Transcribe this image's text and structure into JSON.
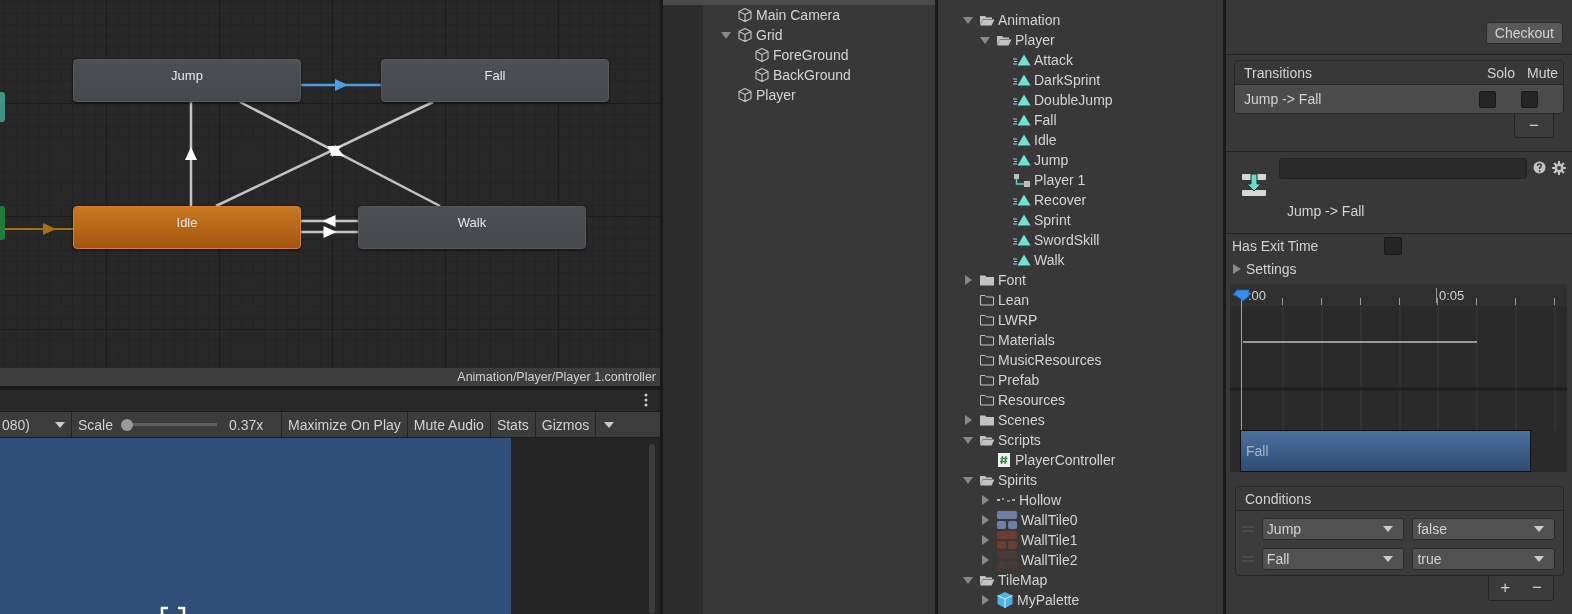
{
  "animator": {
    "states": [
      {
        "name": "Jump",
        "kind": "state"
      },
      {
        "name": "Fall",
        "kind": "state"
      },
      {
        "name": "Idle",
        "kind": "default"
      },
      {
        "name": "Walk",
        "kind": "state"
      }
    ],
    "transitions": [
      {
        "selected": true
      },
      {
        "selected": false
      },
      {
        "selected": false
      },
      {
        "selected": false
      },
      {
        "selected": false
      },
      {
        "selected": false
      }
    ],
    "path": "Animation/Player/Player 1.controller"
  },
  "game": {
    "resolution": "080)",
    "scale": {
      "label": "Scale",
      "level": 0,
      "reading": "0.37x"
    },
    "buttons": [
      "Maximize On Play",
      "Mute Audio",
      "Stats",
      "Gizmos"
    ]
  },
  "hierarchy": {
    "items": [
      {
        "name": "Main Camera",
        "kind": "object"
      },
      {
        "name": "Grid",
        "kind": "object",
        "expanded": true,
        "children": [
          {
            "name": "ForeGround",
            "kind": "object"
          },
          {
            "name": "BackGround",
            "kind": "object"
          }
        ]
      },
      {
        "name": "Player",
        "kind": "object"
      }
    ]
  },
  "project": {
    "items": [
      {
        "name": "Animation",
        "kind": "folder",
        "expanded": true,
        "children": [
          {
            "name": "Player",
            "kind": "folder",
            "expanded": true,
            "children": [
              {
                "name": "Attack",
                "kind": "clip"
              },
              {
                "name": "DarkSprint",
                "kind": "clip"
              },
              {
                "name": "DoubleJump",
                "kind": "clip"
              },
              {
                "name": "Fall",
                "kind": "clip"
              },
              {
                "name": "Idle",
                "kind": "clip"
              },
              {
                "name": "Jump",
                "kind": "clip"
              },
              {
                "name": "Player 1",
                "kind": "controller"
              },
              {
                "name": "Recover",
                "kind": "clip"
              },
              {
                "name": "Sprint",
                "kind": "clip"
              },
              {
                "name": "SwordSkill",
                "kind": "clip"
              },
              {
                "name": "Walk",
                "kind": "clip"
              }
            ]
          }
        ]
      },
      {
        "name": "Font",
        "kind": "folder",
        "expanded": false
      },
      {
        "name": "Lean",
        "kind": "empty-folder"
      },
      {
        "name": "LWRP",
        "kind": "empty-folder"
      },
      {
        "name": "Materials",
        "kind": "empty-folder"
      },
      {
        "name": "MusicResources",
        "kind": "empty-folder"
      },
      {
        "name": "Prefab",
        "kind": "empty-folder"
      },
      {
        "name": "Resources",
        "kind": "empty-folder"
      },
      {
        "name": "Scenes",
        "kind": "folder",
        "expanded": false
      },
      {
        "name": "Scripts",
        "kind": "folder",
        "expanded": true,
        "children": [
          {
            "name": "PlayerController",
            "kind": "script"
          }
        ]
      },
      {
        "name": "Spirits",
        "kind": "folder",
        "expanded": true,
        "children": [
          {
            "name": "Hollow",
            "kind": "slices",
            "expanded": false
          },
          {
            "name": "WallTile0",
            "kind": "sprite",
            "expanded": false,
            "color": "#6f7fa8"
          },
          {
            "name": "WallTile1",
            "kind": "sprite",
            "expanded": false,
            "color": "#6b3e30"
          },
          {
            "name": "WallTile2",
            "kind": "sprite",
            "expanded": false,
            "color": "#4a3a38"
          }
        ]
      },
      {
        "name": "TileMap",
        "kind": "folder",
        "expanded": true,
        "children": [
          {
            "name": "MyPalette",
            "kind": "prefab",
            "expanded": false
          }
        ]
      }
    ]
  },
  "inspector": {
    "checkout_button": "Checkout",
    "transitions": {
      "columns": [
        "Transitions",
        "Solo",
        "Mute"
      ],
      "rows": [
        {
          "name": "Jump -> Fall",
          "selected": true,
          "solo": false,
          "mute": false
        }
      ],
      "remove_button": "−"
    },
    "title": "Jump -> Fall",
    "has_exit_time": {
      "label": "Has Exit Time",
      "checked": false
    },
    "settings": {
      "label": "Settings",
      "expanded": false
    },
    "timeline": {
      "ticks": [
        ":00",
        "0:05"
      ],
      "clip": "Fall"
    },
    "conditions": {
      "title": "Conditions",
      "rows": [
        {
          "parameter": "Jump",
          "value": "false"
        },
        {
          "parameter": "Fall",
          "value": "true"
        }
      ],
      "add_button": "+",
      "remove_button": "−"
    }
  }
}
